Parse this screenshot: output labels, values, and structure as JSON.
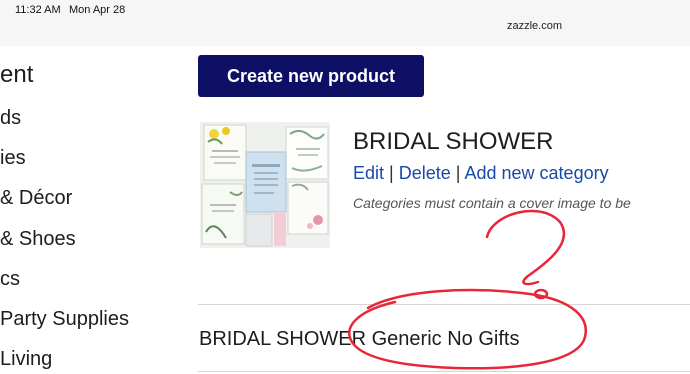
{
  "status_bar": {
    "time": "11:32 AM",
    "date": "Mon Apr 28",
    "url": "zazzle.com"
  },
  "sidebar": {
    "heading": "ent",
    "items": [
      {
        "label": "ds"
      },
      {
        "label": "ies"
      },
      {
        "label": "& Décor"
      },
      {
        "label": "& Shoes"
      },
      {
        "label": "cs"
      },
      {
        "label": "Party Supplies"
      },
      {
        "label": "Living"
      }
    ]
  },
  "main": {
    "create_button_label": "Create new product",
    "category": {
      "title": "BRIDAL SHOWER",
      "edit_label": "Edit",
      "delete_label": "Delete",
      "add_category_label": "Add new category",
      "separator": "|",
      "note": "Categories must contain a cover image to be"
    },
    "subcategory": {
      "title": "BRIDAL SHOWER Generic No Gifts"
    }
  },
  "colors": {
    "button_bg": "#0e1065",
    "link": "#1a4aa8",
    "annotation": "#e8263a"
  }
}
